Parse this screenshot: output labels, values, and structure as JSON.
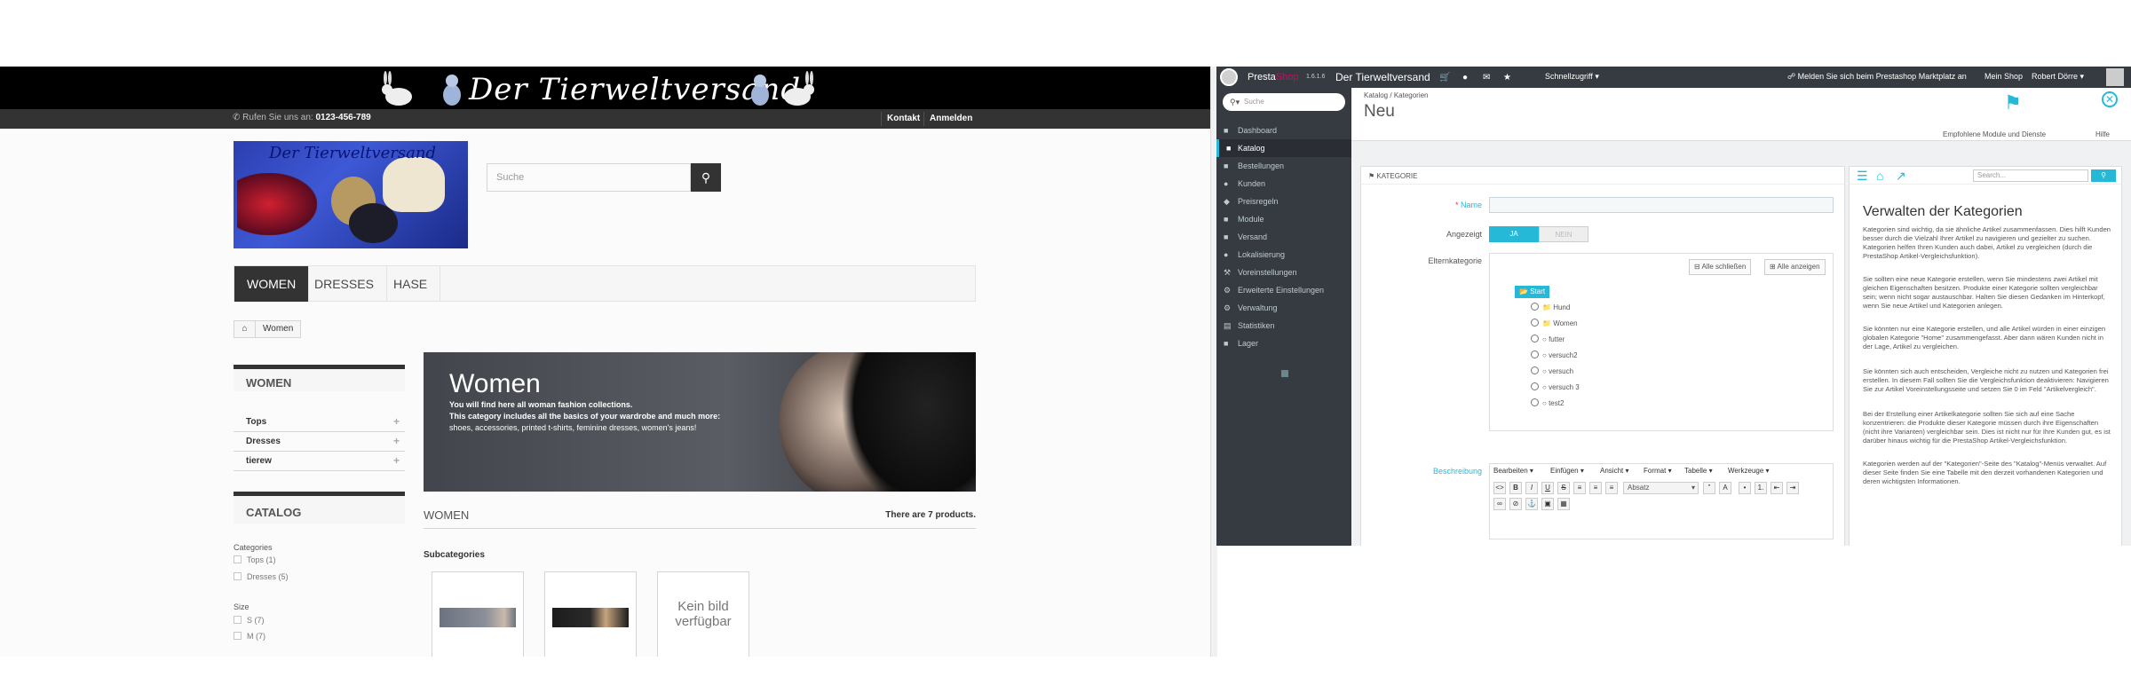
{
  "shop": {
    "banner_title": "Der Tierweltversand",
    "phone_prefix": "Rufen Sie uns an:",
    "phone": "0123-456-789",
    "nav_contact": "Kontakt",
    "nav_login": "Anmelden",
    "logo_text": "Der Tierweltversand",
    "search_placeholder": "Suche",
    "menu": [
      "WOMEN",
      "DRESSES",
      "HASE"
    ],
    "breadcrumb_current": "Women",
    "categories_block_title": "WOMEN",
    "categories": [
      "Tops",
      "Dresses",
      "tierew"
    ],
    "catalog_block_title": "CATALOG",
    "filter_categories_label": "Categories",
    "filter_categories": [
      "Tops (1)",
      "Dresses (5)"
    ],
    "filter_size_label": "Size",
    "filter_sizes": [
      "S (7)",
      "M (7)"
    ],
    "hero_title": "Women",
    "hero_line1": "You will find here all woman fashion collections.",
    "hero_line2": "This category includes all the basics of your wardrobe and much more:",
    "hero_line3": "shoes, accessories, printed t-shirts, feminine dresses, women's jeans!",
    "products_heading": "WOMEN",
    "products_count": "There are 7 products.",
    "subcategories_label": "Subcategories",
    "no_image_text": "Kein bild verfügbar"
  },
  "admin": {
    "brand_a": "Presta",
    "brand_b": "Shop",
    "version": "1.6.1.6",
    "shop_name": "Der Tierweltversand",
    "quick_access": "Schnellzugriff",
    "marketplace_link": "Melden Sie sich beim Prestashop Marktplatz an",
    "my_shop": "Mein Shop",
    "user": "Robert Dörre",
    "sidebar_search_placeholder": "Suche",
    "sidebar": [
      "Dashboard",
      "Katalog",
      "Bestellungen",
      "Kunden",
      "Preisregeln",
      "Module",
      "Versand",
      "Lokalisierung",
      "Voreinstellungen",
      "Erweiterte Einstellungen",
      "Verwaltung",
      "Statistiken",
      "Lager"
    ],
    "breadcrumb_a": "Katalog",
    "breadcrumb_b": "Kategorien",
    "page_title": "Neu",
    "toolbar_modules": "Empfohlene Module und Dienste",
    "toolbar_help": "Hilfe",
    "panel_title": "KATEGORIE",
    "label_name": "Name",
    "label_displayed": "Angezeigt",
    "toggle_yes": "JA",
    "toggle_no": "NEIN",
    "label_parent": "Elternkategorie",
    "collapse_all": "Alle schließen",
    "expand_all": "Alle anzeigen",
    "tree": [
      "Start",
      "Hund",
      "Women",
      "futter",
      "versuch2",
      "versuch",
      "versuch 3",
      "test2"
    ],
    "label_description": "Beschreibung",
    "editor_menus": [
      "Bearbeiten",
      "Einfügen",
      "Ansicht",
      "Format",
      "Tabelle",
      "Werkzeuge"
    ],
    "editor_format": "Absatz",
    "help_search_placeholder": "Search...",
    "help_title": "Verwalten der Kategorien",
    "help_p1": "Kategorien sind wichtig, da sie ähnliche Artikel zusammenfassen. Dies hilft Kunden besser durch die Vielzahl Ihrer Artikel zu navigieren und gezielter zu suchen. Kategorien helfen Ihren Kunden auch dabei, Artikel zu vergleichen (durch die PrestaShop Artikel-Vergleichsfunktion).",
    "help_p2": "Sie sollten eine neue Kategorie erstellen, wenn Sie mindestens zwei Artikel mit gleichen Eigenschaften besitzen. Produkte einer Kategorie sollten vergleichbar sein; wenn nicht sogar austauschbar. Halten Sie diesen Gedanken im Hinterkopf, wenn Sie neue Artikel und Kategorien anlegen.",
    "help_p3": "Sie könnten nur eine Kategorie erstellen, und alle Artikel würden in einer einzigen globalen Kategorie \"Home\" zusammengefasst. Aber dann wären Kunden nicht in der Lage, Artikel zu vergleichen.",
    "help_p4": "Sie könnten sich auch entscheiden, Vergleiche nicht zu nutzen und Kategorien frei erstellen. In diesem Fall sollten Sie die Vergleichsfunktion deaktivieren: Navigieren Sie zur Artikel Voreinstellungsseite und setzen Sie 0 im Feld \"Artikelvergleich\".",
    "help_p5": "Bei der Erstellung einer Artikelkategorie sollten Sie sich auf eine Sache konzentrieren: die Produkte dieser Kategorie müssen durch ihre Eigenschaften (nicht ihre Varianten) vergleichbar sein. Dies ist nicht nur für Ihre Kunden gut, es ist darüber hinaus wichtig für die PrestaShop Artikel-Vergleichsfunktion.",
    "help_p6": "Kategorien werden auf der \"Kategorien\"-Seite des \"Katalog\"-Menüs verwaltet. Auf dieser Seite finden Sie eine Tabelle mit den derzeit vorhandenen Kategorien und deren wichtigsten Informationen."
  },
  "colors": {
    "admin_accent": "#25b9d7",
    "admin_dark": "#363a41",
    "shop_dark": "#333333",
    "brand_pink": "#df0067"
  }
}
